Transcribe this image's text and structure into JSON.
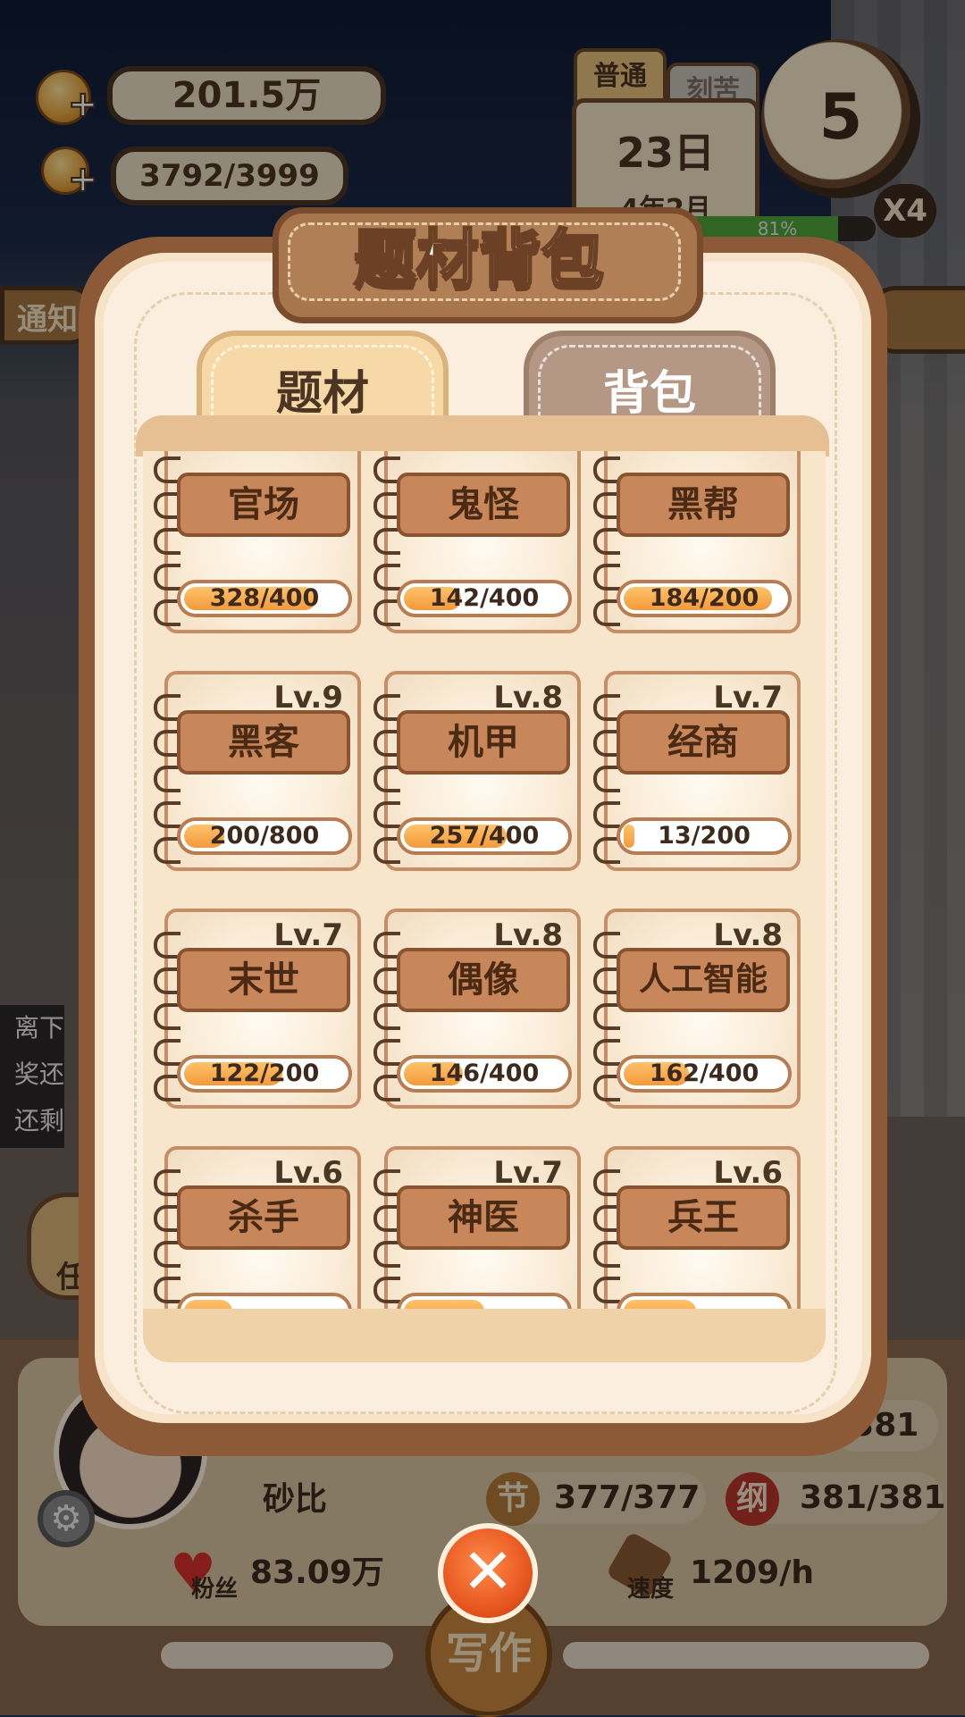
{
  "hud": {
    "coins": "201.5万",
    "inspiration": "3792/3999",
    "mode_tab_active": "普通",
    "mode_tab_other": "刻苦",
    "day": "23日",
    "year_month": "4年2月",
    "progress_pct": "81%",
    "clock_value": "5",
    "speed_multiplier": "X4",
    "left_banner": "通知",
    "side_notice": [
      "离下",
      "奖还",
      "还剩"
    ],
    "left_button_partial": "任"
  },
  "modal": {
    "title": "题材背包",
    "tabs": [
      {
        "label": "题材",
        "active": true
      },
      {
        "label": "背包",
        "active": false
      }
    ],
    "genres": [
      {
        "name": "官场",
        "level": "",
        "progress": "328/400",
        "fill": 0.82
      },
      {
        "name": "鬼怪",
        "level": "",
        "progress": "142/400",
        "fill": 0.355
      },
      {
        "name": "黑帮",
        "level": "",
        "progress": "184/200",
        "fill": 0.92
      },
      {
        "name": "黑客",
        "level": "Lv.9",
        "progress": "200/800",
        "fill": 0.25
      },
      {
        "name": "机甲",
        "level": "Lv.8",
        "progress": "257/400",
        "fill": 0.64
      },
      {
        "name": "经商",
        "level": "Lv.7",
        "progress": "13/200",
        "fill": 0.065
      },
      {
        "name": "末世",
        "level": "Lv.7",
        "progress": "122/200",
        "fill": 0.61
      },
      {
        "name": "偶像",
        "level": "Lv.8",
        "progress": "146/400",
        "fill": 0.365
      },
      {
        "name": "人工智能",
        "level": "Lv.8",
        "progress": "162/400",
        "fill": 0.405
      },
      {
        "name": "杀手",
        "level": "Lv.6",
        "progress": "",
        "fill": 0.3
      },
      {
        "name": "神医",
        "level": "Lv.7",
        "progress": "",
        "fill": 0.5
      },
      {
        "name": "兵王",
        "level": "Lv.6",
        "progress": "",
        "fill": 0.45
      }
    ]
  },
  "profile": {
    "name": "砂比",
    "stat_top_partial": "/381",
    "jie_badge": "节",
    "jie_value": "377/377",
    "gang_badge": "纲",
    "gang_value": "381/381",
    "fans_label": "粉丝",
    "fans_value": "83.09万",
    "speed_label": "速度",
    "speed_value": "1209/h",
    "write_button": "写作"
  },
  "colors": {
    "modal_frame": "#8d5a37",
    "card_border": "#c58e66",
    "bar_fill": "#f39a3a",
    "close_button": "#e6541e"
  }
}
